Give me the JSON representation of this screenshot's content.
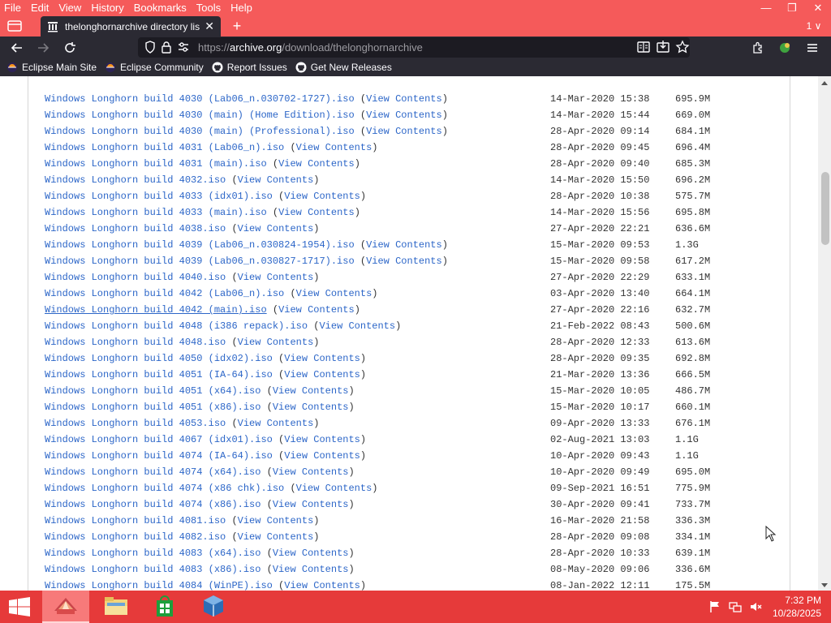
{
  "menubar": {
    "items": [
      "File",
      "Edit",
      "View",
      "History",
      "Bookmarks",
      "Tools",
      "Help"
    ]
  },
  "window_controls": {
    "minimize": "—",
    "restore": "❐",
    "close": "✕"
  },
  "tabbar": {
    "active_tab_title": "thelonghornarchive directory lis",
    "close_glyph": "✕",
    "new_tab_glyph": "+",
    "tab_list_glyph": "1 ∨"
  },
  "navbar": {
    "url_prefix": "https://",
    "url_host": "archive.org",
    "url_path": "/download/thelonghornarchive"
  },
  "bookmarks": [
    {
      "label": "Eclipse Main Site",
      "icon": "eclipse-icon"
    },
    {
      "label": "Eclipse Community",
      "icon": "eclipse-icon"
    },
    {
      "label": "Report Issues",
      "icon": "github-icon"
    },
    {
      "label": "Get New Releases",
      "icon": "github-icon"
    }
  ],
  "listing": {
    "view_contents_label": "View Contents",
    "rows": [
      {
        "name": "Windows Longhorn build 4030 (Lab06_n.030702-1727).iso",
        "date": "14-Mar-2020 15:38",
        "size": "695.9M"
      },
      {
        "name": "Windows Longhorn build 4030 (main) (Home Edition).iso",
        "date": "14-Mar-2020 15:44",
        "size": "669.0M"
      },
      {
        "name": "Windows Longhorn build 4030 (main) (Professional).iso",
        "date": "28-Apr-2020 09:14",
        "size": "684.1M"
      },
      {
        "name": "Windows Longhorn build 4031 (Lab06_n).iso",
        "date": "28-Apr-2020 09:45",
        "size": "696.4M"
      },
      {
        "name": "Windows Longhorn build 4031 (main).iso",
        "date": "28-Apr-2020 09:40",
        "size": "685.3M"
      },
      {
        "name": "Windows Longhorn build 4032.iso",
        "date": "14-Mar-2020 15:50",
        "size": "696.2M"
      },
      {
        "name": "Windows Longhorn build 4033 (idx01).iso",
        "date": "28-Apr-2020 10:38",
        "size": "575.7M"
      },
      {
        "name": "Windows Longhorn build 4033 (main).iso",
        "date": "14-Mar-2020 15:56",
        "size": "695.8M"
      },
      {
        "name": "Windows Longhorn build 4038.iso",
        "date": "27-Apr-2020 22:21",
        "size": "636.6M"
      },
      {
        "name": "Windows Longhorn build 4039 (Lab06_n.030824-1954).iso",
        "date": "15-Mar-2020 09:53",
        "size": "1.3G"
      },
      {
        "name": "Windows Longhorn build 4039 (Lab06_n.030827-1717).iso",
        "date": "15-Mar-2020 09:58",
        "size": "617.2M"
      },
      {
        "name": "Windows Longhorn build 4040.iso",
        "date": "27-Apr-2020 22:29",
        "size": "633.1M"
      },
      {
        "name": "Windows Longhorn build 4042 (Lab06_n).iso",
        "date": "03-Apr-2020 13:40",
        "size": "664.1M"
      },
      {
        "name": "Windows Longhorn build 4042 (main).iso",
        "date": "27-Apr-2020 22:16",
        "size": "632.7M"
      },
      {
        "name": "Windows Longhorn build 4048 (i386 repack).iso",
        "date": "21-Feb-2022 08:43",
        "size": "500.6M"
      },
      {
        "name": "Windows Longhorn build 4048.iso",
        "date": "28-Apr-2020 12:33",
        "size": "613.6M"
      },
      {
        "name": "Windows Longhorn build 4050 (idx02).iso",
        "date": "28-Apr-2020 09:35",
        "size": "692.8M"
      },
      {
        "name": "Windows Longhorn build 4051 (IA-64).iso",
        "date": "21-Mar-2020 13:36",
        "size": "666.5M"
      },
      {
        "name": "Windows Longhorn build 4051 (x64).iso",
        "date": "15-Mar-2020 10:05",
        "size": "486.7M"
      },
      {
        "name": "Windows Longhorn build 4051 (x86).iso",
        "date": "15-Mar-2020 10:17",
        "size": "660.1M"
      },
      {
        "name": "Windows Longhorn build 4053.iso",
        "date": "09-Apr-2020 13:33",
        "size": "676.1M"
      },
      {
        "name": "Windows Longhorn build 4067 (idx01).iso",
        "date": "02-Aug-2021 13:03",
        "size": "1.1G"
      },
      {
        "name": "Windows Longhorn build 4074 (IA-64).iso",
        "date": "10-Apr-2020 09:43",
        "size": "1.1G"
      },
      {
        "name": "Windows Longhorn build 4074 (x64).iso",
        "date": "10-Apr-2020 09:49",
        "size": "695.0M"
      },
      {
        "name": "Windows Longhorn build 4074 (x86 chk).iso",
        "date": "09-Sep-2021 16:51",
        "size": "775.9M"
      },
      {
        "name": "Windows Longhorn build 4074 (x86).iso",
        "date": "30-Apr-2020 09:41",
        "size": "733.7M"
      },
      {
        "name": "Windows Longhorn build 4081.iso",
        "date": "16-Mar-2020 21:58",
        "size": "336.3M"
      },
      {
        "name": "Windows Longhorn build 4082.iso",
        "date": "28-Apr-2020 09:08",
        "size": "334.1M"
      },
      {
        "name": "Windows Longhorn build 4083 (x64).iso",
        "date": "28-Apr-2020 10:33",
        "size": "639.1M"
      },
      {
        "name": "Windows Longhorn build 4083 (x86).iso",
        "date": "08-May-2020 09:06",
        "size": "336.6M"
      },
      {
        "name": "Windows Longhorn build 4084 (WinPE).iso",
        "date": "08-Jan-2022 12:11",
        "size": "175.5M"
      }
    ]
  },
  "taskbar": {
    "apps": [
      {
        "name": "firefox-app",
        "icon": "firefox-icon"
      },
      {
        "name": "file-explorer-app",
        "icon": "folder-icon"
      },
      {
        "name": "store-app",
        "icon": "store-icon"
      },
      {
        "name": "virtualbox-app",
        "icon": "virtualbox-icon"
      }
    ],
    "time": "7:32 PM",
    "date": "10/28/2025"
  },
  "colors": {
    "accent_red": "#f55a5a",
    "taskbar_red": "#e63a3a",
    "link_blue": "#2c66c8",
    "toolbar_dark": "#2b2a33"
  }
}
